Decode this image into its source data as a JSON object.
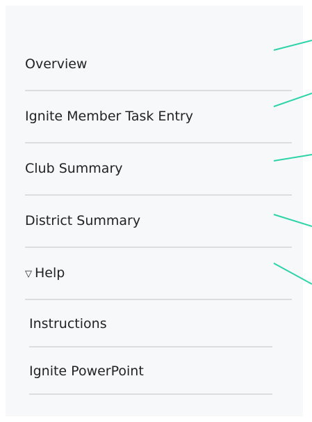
{
  "nav": {
    "items": [
      {
        "label": "Overview"
      },
      {
        "label": "Ignite Member Task Entry"
      },
      {
        "label": "Club Summary"
      },
      {
        "label": "District Summary"
      },
      {
        "label": "Help",
        "expanded": true,
        "icon": "triangle-down-icon"
      }
    ],
    "help_children": [
      {
        "label": "Instructions"
      },
      {
        "label": "Ignite PowerPoint"
      }
    ]
  },
  "colors": {
    "panel_bg": "#f7f8fa",
    "divider": "#dcdde0",
    "connector": "#2ed3a7",
    "text": "#222222"
  }
}
